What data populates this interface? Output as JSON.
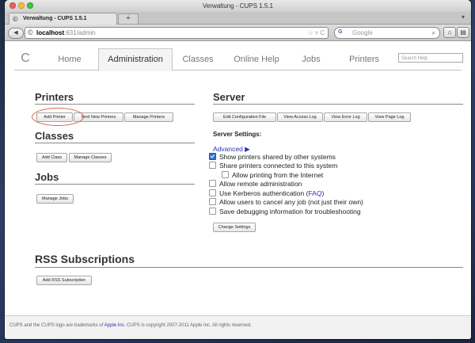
{
  "window": {
    "title": "Verwaltung - CUPS 1.5.1"
  },
  "tabbar": {
    "tab_title": "Verwaltung - CUPS 1.5.1",
    "new_tab_glyph": "+",
    "chevron_glyph": "▾"
  },
  "navbar": {
    "back_glyph": "◀",
    "url_host": "localhost",
    "url_path": ":631/admin",
    "url_right_glyphs": "☆ ▿ C",
    "search_engine": "G",
    "search_placeholder": "Google",
    "search_glyph": "⌕",
    "home_glyph": "⌂",
    "menu_glyph": "▤"
  },
  "cups": {
    "logo_glyph": "C",
    "nav": [
      "Home",
      "Administration",
      "Classes",
      "Online Help",
      "Jobs",
      "Printers"
    ],
    "active_nav": "Administration",
    "search_placeholder": "Search Help",
    "printers": {
      "heading": "Printers",
      "buttons": [
        "Add Printer",
        "Find New Printers",
        "Manage Printers"
      ]
    },
    "classes": {
      "heading": "Classes",
      "buttons": [
        "Add Class",
        "Manage Classes"
      ]
    },
    "jobs": {
      "heading": "Jobs",
      "buttons": [
        "Manage Jobs"
      ]
    },
    "server": {
      "heading": "Server",
      "buttons": [
        "Edit Configuration File",
        "View Access Log",
        "View Error Log",
        "View Page Log"
      ],
      "settings_heading": "Server Settings:",
      "advanced_link": "Advanced ▶",
      "options": [
        {
          "label": "Show printers shared by other systems",
          "checked": true
        },
        {
          "label": "Share printers connected to this system",
          "checked": false
        },
        {
          "label": "Allow printing from the Internet",
          "checked": false
        },
        {
          "label": "Allow remote administration",
          "checked": false
        },
        {
          "label": "Use Kerberos authentication (",
          "link": "FAQ",
          "suffix": ")",
          "checked": false
        },
        {
          "label": "Allow users to cancel any job (not just their own)",
          "checked": false
        },
        {
          "label": "Save debugging information for troubleshooting",
          "checked": false
        }
      ],
      "change_button": "Change Settings"
    },
    "rss": {
      "heading": "RSS Subscriptions",
      "button": "Add RSS Subscription"
    },
    "footer": {
      "pre": "CUPS and the CUPS logo are trademarks of ",
      "link": "Apple Inc.",
      "post": " CUPS is copyright 2007-2011 Apple Inc. All rights reserved."
    }
  },
  "colors": {
    "link": "#2a32b8",
    "highlight_ring": "#d9624a"
  }
}
